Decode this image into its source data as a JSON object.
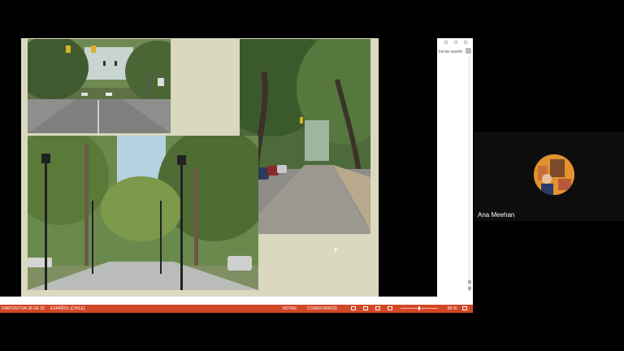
{
  "powerpoint": {
    "sign_in": "Iniciar sesión",
    "status": {
      "slide": "DIAPOSITIVA 28 DE 32",
      "language": "ESPAÑOL (CHILE)",
      "notes": "NOTAS",
      "comments": "COMENTARIOS",
      "zoom": "80 %"
    }
  },
  "participant": {
    "name": "Ana Meehan"
  },
  "colors": {
    "status_bar": "#d24726",
    "slide_background": "#dad8bf"
  },
  "icons": [
    "normal-view-icon",
    "slide-sorter-icon",
    "reading-view-icon",
    "slideshow-icon",
    "fit-to-window-icon"
  ]
}
